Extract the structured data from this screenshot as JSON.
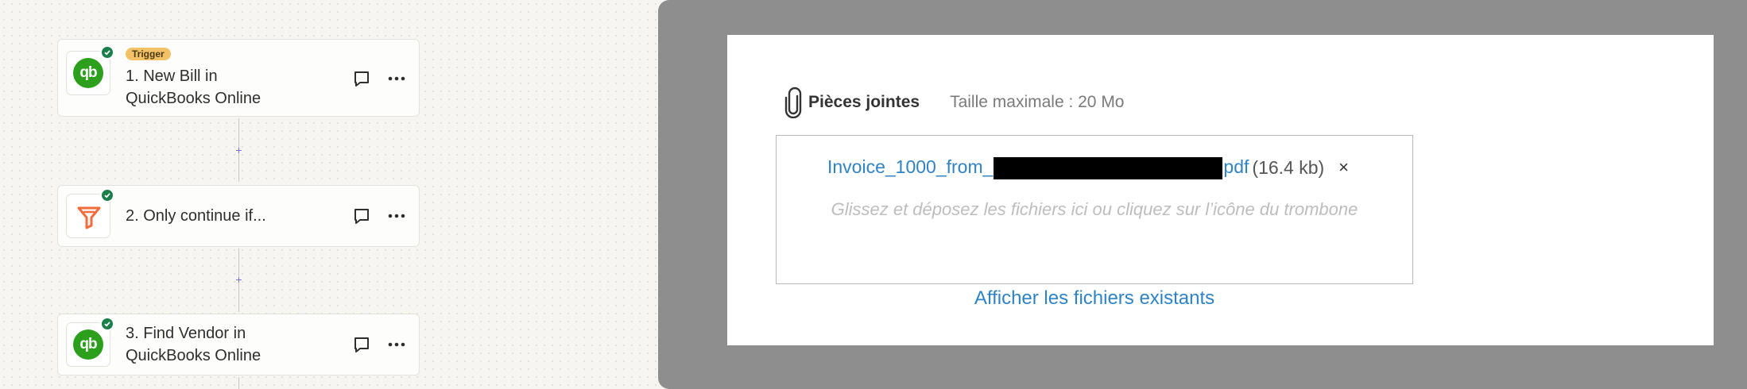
{
  "editor": {
    "steps": [
      {
        "badge": "Trigger",
        "title_line1": "1. New Bill in",
        "title_line2": "QuickBooks Online",
        "app_logo": "qb"
      },
      {
        "title_line1": "2. Only continue if...",
        "app_logo": "filter"
      },
      {
        "title_line1": "3. Find Vendor in",
        "title_line2": "QuickBooks Online",
        "app_logo": "qb"
      }
    ],
    "add_step_symbol": "+",
    "icons": {
      "status": "check-circle-icon",
      "comment": "comment-icon",
      "more": "more-horizontal-icon"
    },
    "colors": {
      "quickbooks_green": "#2ca01c",
      "filter_orange": "#f26b3a",
      "trigger_badge": "#f3c266",
      "status_green": "#1a7f4b"
    }
  },
  "attachments": {
    "icon": "paperclip-icon",
    "title": "Pièces jointes",
    "max_size": "Taille maximale : 20 Mo",
    "file": {
      "name_prefix": "Invoice_1000_from_",
      "name_suffix": "pdf",
      "size": "(16.4 kb)",
      "remove_symbol": "×"
    },
    "drop_hint": "Glissez et déposez les fichiers ici ou cliquez sur l’icône du trombone",
    "show_existing_link": "Afficher les fichiers existants",
    "colors": {
      "link": "#2f83c4",
      "overlay": "#8e8e8e"
    }
  }
}
